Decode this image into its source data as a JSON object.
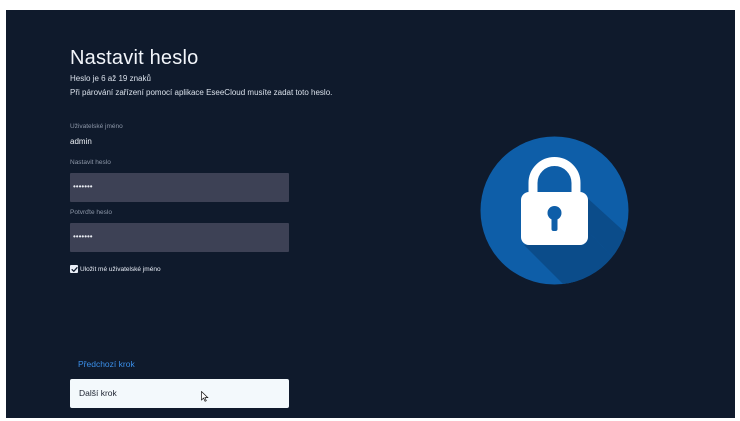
{
  "page": {
    "title": "Nastavit heslo",
    "subtitle_length": "Heslo je 6 až 19 znaků",
    "subtitle_pairing": "Při párování zařízení pomocí aplikace EseeCloud musíte zadat toto heslo."
  },
  "form": {
    "username_label": "Uživatelské jméno",
    "username_value": "admin",
    "password_label": "Nastavit heslo",
    "password_value": "•••••••",
    "confirm_label": "Potvrďte heslo",
    "confirm_value": "•••••••",
    "remember_label": "Uložit mé uživatelské jméno",
    "remember_checked": true
  },
  "actions": {
    "previous_label": "Předchozí krok",
    "next_label": "Další krok"
  },
  "illustration": {
    "icon": "lock-icon",
    "circle_color": "#0e5ea8",
    "shadow_color": "#0b4c8a",
    "lock_color": "#ffffff"
  },
  "colors": {
    "background": "#0f1a2c",
    "field": "#3d4155",
    "link": "#3a8ee8",
    "button": "#f3f9fc"
  }
}
